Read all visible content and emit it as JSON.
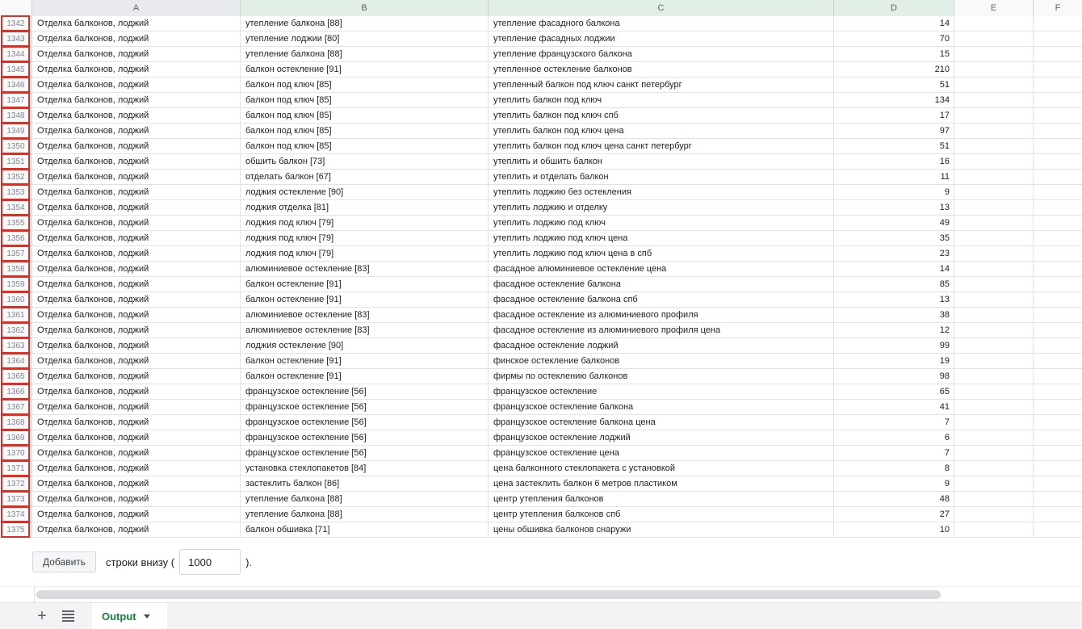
{
  "colors": {
    "header_green": "#e2efe6",
    "header_gray": "#e8eaed",
    "annotation_red": "#e82b20",
    "tab_green": "#188038",
    "gridline": "#e2e2e2"
  },
  "sheet": {
    "column_headers": [
      "A",
      "B",
      "C",
      "D",
      "E",
      "F"
    ],
    "rows": [
      {
        "num": "1342",
        "a": "Отделка балконов, лоджий",
        "b": "утепление балкона [88]",
        "c": "утепление фасадного балкона",
        "d": "14"
      },
      {
        "num": "1343",
        "a": "Отделка балконов, лоджий",
        "b": "утепление лоджии [80]",
        "c": "утепление фасадных лоджии",
        "d": "70"
      },
      {
        "num": "1344",
        "a": "Отделка балконов, лоджий",
        "b": "утепление балкона [88]",
        "c": "утепление французского балкона",
        "d": "15"
      },
      {
        "num": "1345",
        "a": "Отделка балконов, лоджий",
        "b": "балкон остекление [91]",
        "c": "утепленное остекление балконов",
        "d": "210"
      },
      {
        "num": "1346",
        "a": "Отделка балконов, лоджий",
        "b": "балкон под ключ [85]",
        "c": "утепленный балкон под ключ санкт петербург",
        "d": "51"
      },
      {
        "num": "1347",
        "a": "Отделка балконов, лоджий",
        "b": "балкон под ключ [85]",
        "c": "утеплить балкон под ключ",
        "d": "134"
      },
      {
        "num": "1348",
        "a": "Отделка балконов, лоджий",
        "b": "балкон под ключ [85]",
        "c": "утеплить балкон под ключ спб",
        "d": "17"
      },
      {
        "num": "1349",
        "a": "Отделка балконов, лоджий",
        "b": "балкон под ключ [85]",
        "c": "утеплить балкон под ключ цена",
        "d": "97"
      },
      {
        "num": "1350",
        "a": "Отделка балконов, лоджий",
        "b": "балкон под ключ [85]",
        "c": "утеплить балкон под ключ цена санкт петербург",
        "d": "51"
      },
      {
        "num": "1351",
        "a": "Отделка балконов, лоджий",
        "b": "обшить балкон [73]",
        "c": "утеплить и обшить балкон",
        "d": "16"
      },
      {
        "num": "1352",
        "a": "Отделка балконов, лоджий",
        "b": "отделать балкон [67]",
        "c": "утеплить и отделать балкон",
        "d": "11"
      },
      {
        "num": "1353",
        "a": "Отделка балконов, лоджий",
        "b": "лоджия остекление [90]",
        "c": "утеплить лоджию без остекления",
        "d": "9"
      },
      {
        "num": "1354",
        "a": "Отделка балконов, лоджий",
        "b": "лоджия отделка [81]",
        "c": "утеплить лоджию и отделку",
        "d": "13"
      },
      {
        "num": "1355",
        "a": "Отделка балконов, лоджий",
        "b": "лоджия под ключ [79]",
        "c": "утеплить лоджию под ключ",
        "d": "49"
      },
      {
        "num": "1356",
        "a": "Отделка балконов, лоджий",
        "b": "лоджия под ключ [79]",
        "c": "утеплить лоджию под ключ цена",
        "d": "35"
      },
      {
        "num": "1357",
        "a": "Отделка балконов, лоджий",
        "b": "лоджия под ключ [79]",
        "c": "утеплить лоджию под ключ цена в спб",
        "d": "23"
      },
      {
        "num": "1358",
        "a": "Отделка балконов, лоджий",
        "b": "алюминиевое остекление [83]",
        "c": "фасадное алюминиевое остекление цена",
        "d": "14"
      },
      {
        "num": "1359",
        "a": "Отделка балконов, лоджий",
        "b": "балкон остекление [91]",
        "c": "фасадное остекление балкона",
        "d": "85"
      },
      {
        "num": "1360",
        "a": "Отделка балконов, лоджий",
        "b": "балкон остекление [91]",
        "c": "фасадное остекление балкона спб",
        "d": "13"
      },
      {
        "num": "1361",
        "a": "Отделка балконов, лоджий",
        "b": "алюминиевое остекление [83]",
        "c": "фасадное остекление из алюминиевого профиля",
        "d": "38"
      },
      {
        "num": "1362",
        "a": "Отделка балконов, лоджий",
        "b": "алюминиевое остекление [83]",
        "c": "фасадное остекление из алюминиевого профиля цена",
        "d": "12"
      },
      {
        "num": "1363",
        "a": "Отделка балконов, лоджий",
        "b": "лоджия остекление [90]",
        "c": "фасадное остекление лоджий",
        "d": "99"
      },
      {
        "num": "1364",
        "a": "Отделка балконов, лоджий",
        "b": "балкон остекление [91]",
        "c": "финское остекление балконов",
        "d": "19"
      },
      {
        "num": "1365",
        "a": "Отделка балконов, лоджий",
        "b": "балкон остекление [91]",
        "c": "фирмы по остеклению балконов",
        "d": "98"
      },
      {
        "num": "1366",
        "a": "Отделка балконов, лоджий",
        "b": "французское остекление [56]",
        "c": "французское остекление",
        "d": "65"
      },
      {
        "num": "1367",
        "a": "Отделка балконов, лоджий",
        "b": "французское остекление [56]",
        "c": "французское остекление балкона",
        "d": "41"
      },
      {
        "num": "1368",
        "a": "Отделка балконов, лоджий",
        "b": "французское остекление [56]",
        "c": "французское остекление балкона цена",
        "d": "7"
      },
      {
        "num": "1369",
        "a": "Отделка балконов, лоджий",
        "b": "французское остекление [56]",
        "c": "французское остекление лоджий",
        "d": "6"
      },
      {
        "num": "1370",
        "a": "Отделка балконов, лоджий",
        "b": "французское остекление [56]",
        "c": "французское остекление цена",
        "d": "7"
      },
      {
        "num": "1371",
        "a": "Отделка балконов, лоджий",
        "b": "установка стеклопакетов [84]",
        "c": "цена балконного стеклопакета с установкой",
        "d": "8"
      },
      {
        "num": "1372",
        "a": "Отделка балконов, лоджий",
        "b": "застеклить балкон [86]",
        "c": "цена застеклить балкон 6 метров пластиком",
        "d": "9"
      },
      {
        "num": "1373",
        "a": "Отделка балконов, лоджий",
        "b": "утепление балкона [88]",
        "c": "центр утепления балконов",
        "d": "48"
      },
      {
        "num": "1374",
        "a": "Отделка балконов, лоджий",
        "b": "утепление балкона [88]",
        "c": "центр утепления балконов спб",
        "d": "27"
      },
      {
        "num": "1375",
        "a": "Отделка балконов, лоджий",
        "b": "балкон обшивка [71]",
        "c": "цены обшивка балконов снаружи",
        "d": "10"
      }
    ]
  },
  "add_rows": {
    "button_label": "Добавить",
    "label_before": "строки внизу (",
    "count_value": "1000",
    "label_after": ")."
  },
  "sheet_bar": {
    "active_tab_label": "Output"
  }
}
